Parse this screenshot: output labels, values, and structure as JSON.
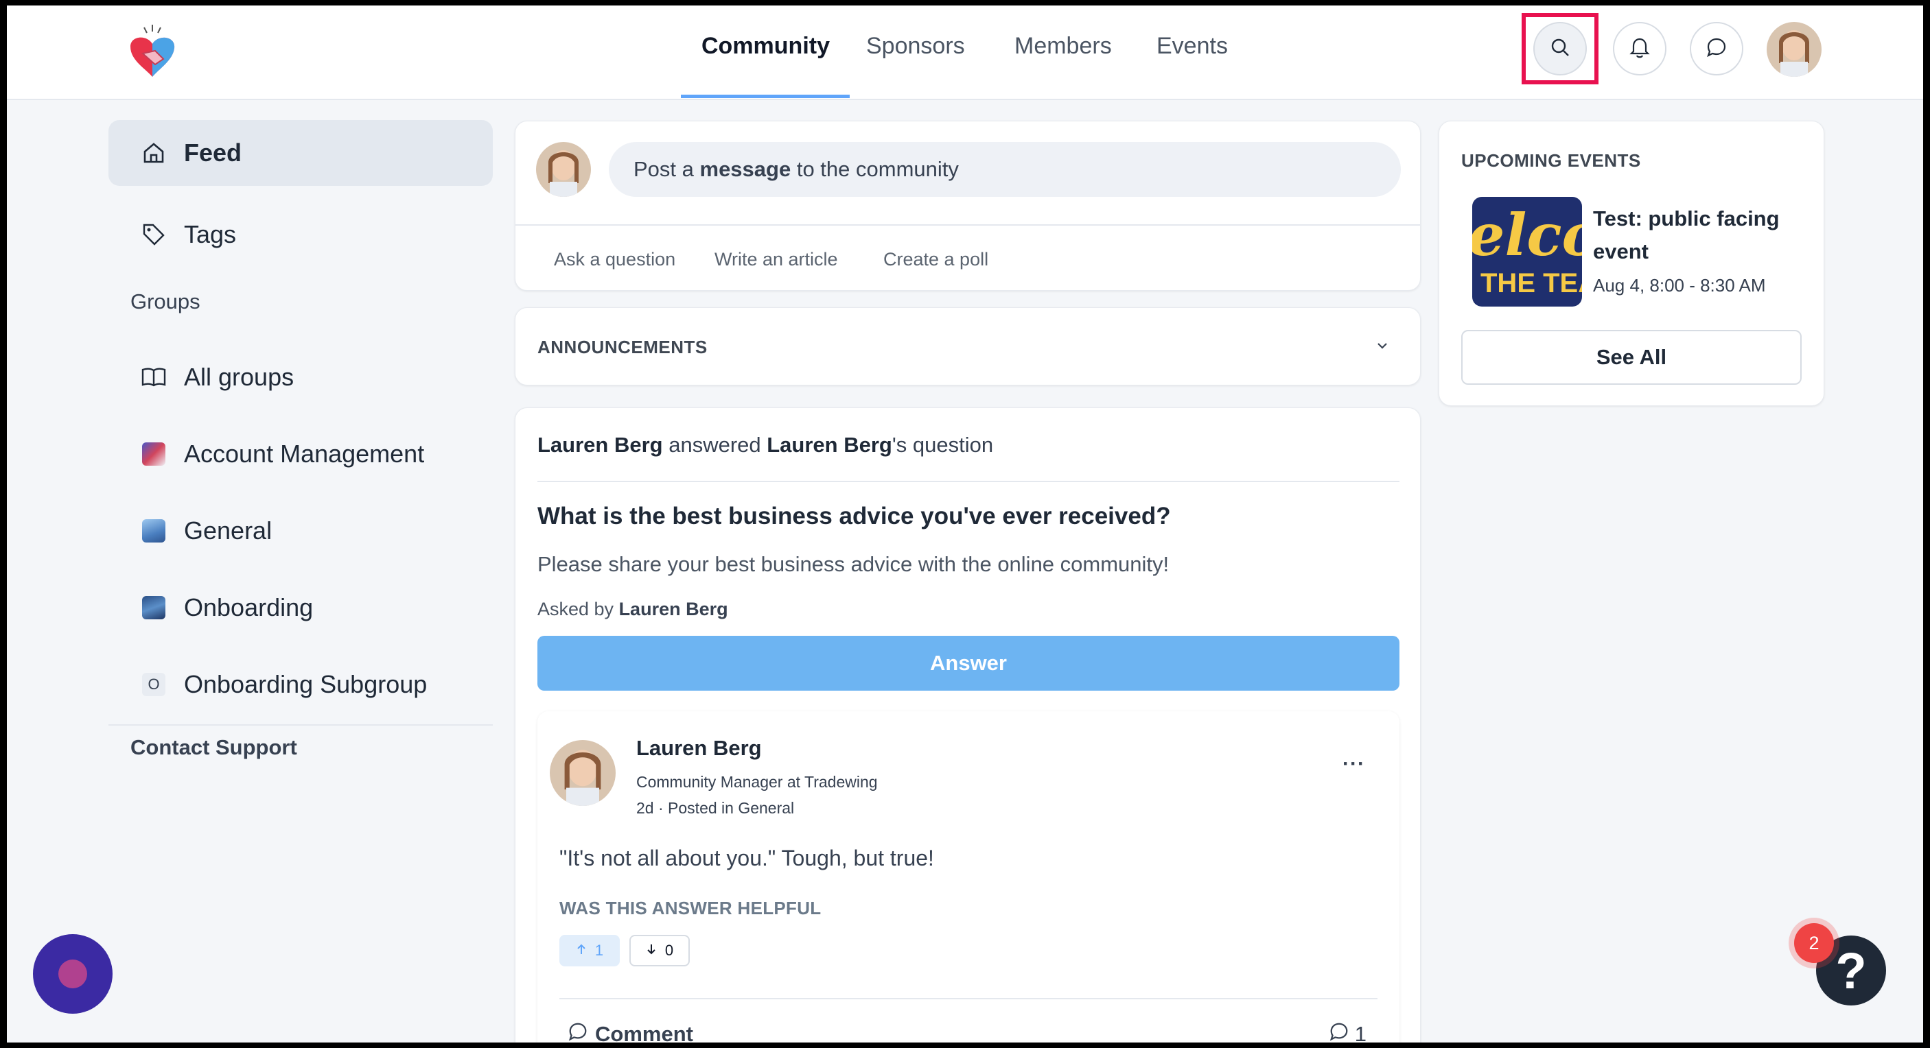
{
  "brand": {
    "logo_icon": "handshake-heart-logo",
    "accent": "#60a5fa",
    "highlight": "#e8114f"
  },
  "nav": {
    "tabs": [
      {
        "label": "Community",
        "active": true
      },
      {
        "label": "Sponsors"
      },
      {
        "label": "Members"
      },
      {
        "label": "Events"
      }
    ]
  },
  "sidebar": {
    "feed": "Feed",
    "tags": "Tags",
    "groups_heading": "Groups",
    "groups": [
      {
        "label": "All groups"
      },
      {
        "label": "Account Management"
      },
      {
        "label": "General"
      },
      {
        "label": "Onboarding"
      },
      {
        "label": "Onboarding Subgroup",
        "initial": "O"
      }
    ],
    "contact_support": "Contact Support"
  },
  "composer": {
    "placeholder_pre": "Post a ",
    "placeholder_bold": "message",
    "placeholder_post": " to the community",
    "actions": [
      "Ask a question",
      "Write an article",
      "Create a poll"
    ]
  },
  "announcements": {
    "title": "ANNOUNCEMENTS"
  },
  "post": {
    "activity_actor": "Lauren Berg",
    "activity_verb": " answered ",
    "activity_target": "Lauren Berg",
    "activity_suffix": "'s question",
    "question_title": "What is the best business advice you've ever received?",
    "question_body": "Please share your best business advice with the online community!",
    "asked_by_prefix": "Asked by ",
    "asked_by_name": "Lauren Berg",
    "answer_button": "Answer",
    "answer": {
      "author": "Lauren Berg",
      "role": "Community Manager at Tradewing",
      "time": "2d",
      "posted_in": "Posted in General",
      "text": "\"It's not all about you.\" Tough, but true!",
      "helpful_label": "WAS THIS ANSWER HELPFUL",
      "upvotes": "1",
      "downvotes": "0",
      "comment_label": "Comment",
      "comment_count": "1"
    }
  },
  "events": {
    "title": "UPCOMING EVENTS",
    "thumb_text_top": "elcon",
    "thumb_text_bottom": "THE TEA",
    "name": "Test: public facing event",
    "time": "Aug 4, 8:00 - 8:30 AM",
    "see_all": "See All"
  },
  "floating": {
    "help_badge": "2",
    "help_glyph": "?"
  }
}
